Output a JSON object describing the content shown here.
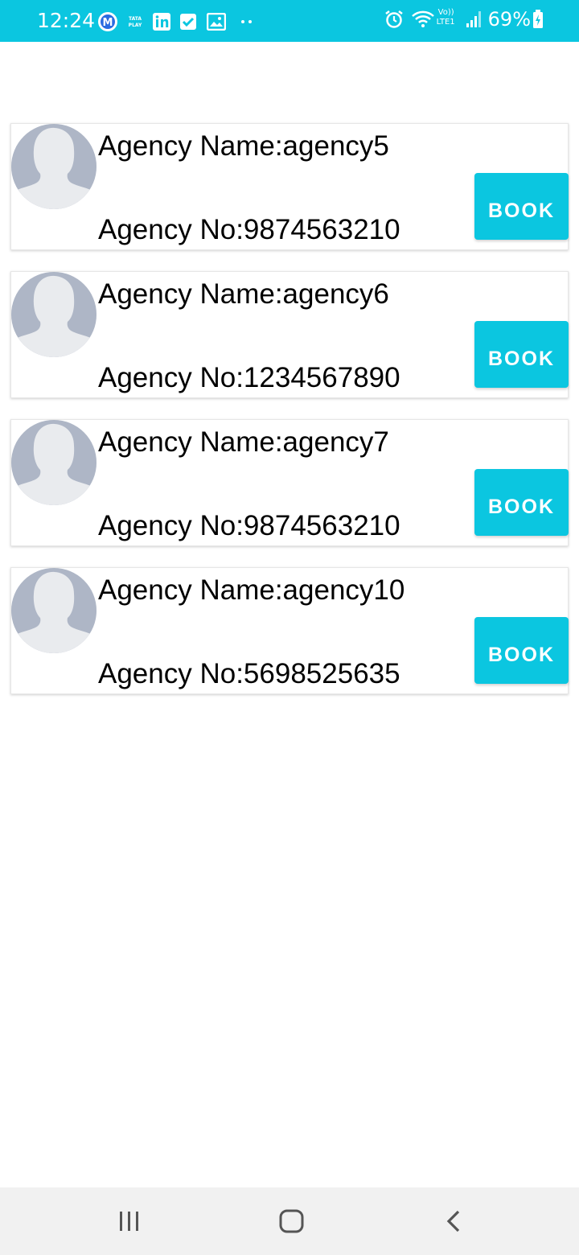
{
  "status_bar": {
    "time": "12:24",
    "battery": "69%",
    "left_icons": [
      "m-app-icon",
      "tata-play-icon",
      "linkedin-icon",
      "check-icon",
      "image-icon",
      "more-dots-icon"
    ],
    "right_icons": [
      "alarm-icon",
      "wifi-icon",
      "volte-signal-icon",
      "battery-icon"
    ],
    "volte_label": "Vo))",
    "lte_label": "LTE1",
    "tata_label": "TATA PLAY",
    "accent_color": "#0bc6e0"
  },
  "agencies": [
    {
      "name": "Agency Name:agency5",
      "number": "Agency No:9874563210",
      "button": "BOOK"
    },
    {
      "name": "Agency Name:agency6",
      "number": "Agency No:1234567890",
      "button": "BOOK"
    },
    {
      "name": "Agency Name:agency7",
      "number": "Agency No:9874563210",
      "button": "BOOK"
    },
    {
      "name": "Agency Name:agency10",
      "number": "Agency No:5698525635",
      "button": "BOOK"
    }
  ],
  "nav_bar": {
    "buttons": [
      "recent-apps-icon",
      "home-icon",
      "back-icon"
    ]
  }
}
